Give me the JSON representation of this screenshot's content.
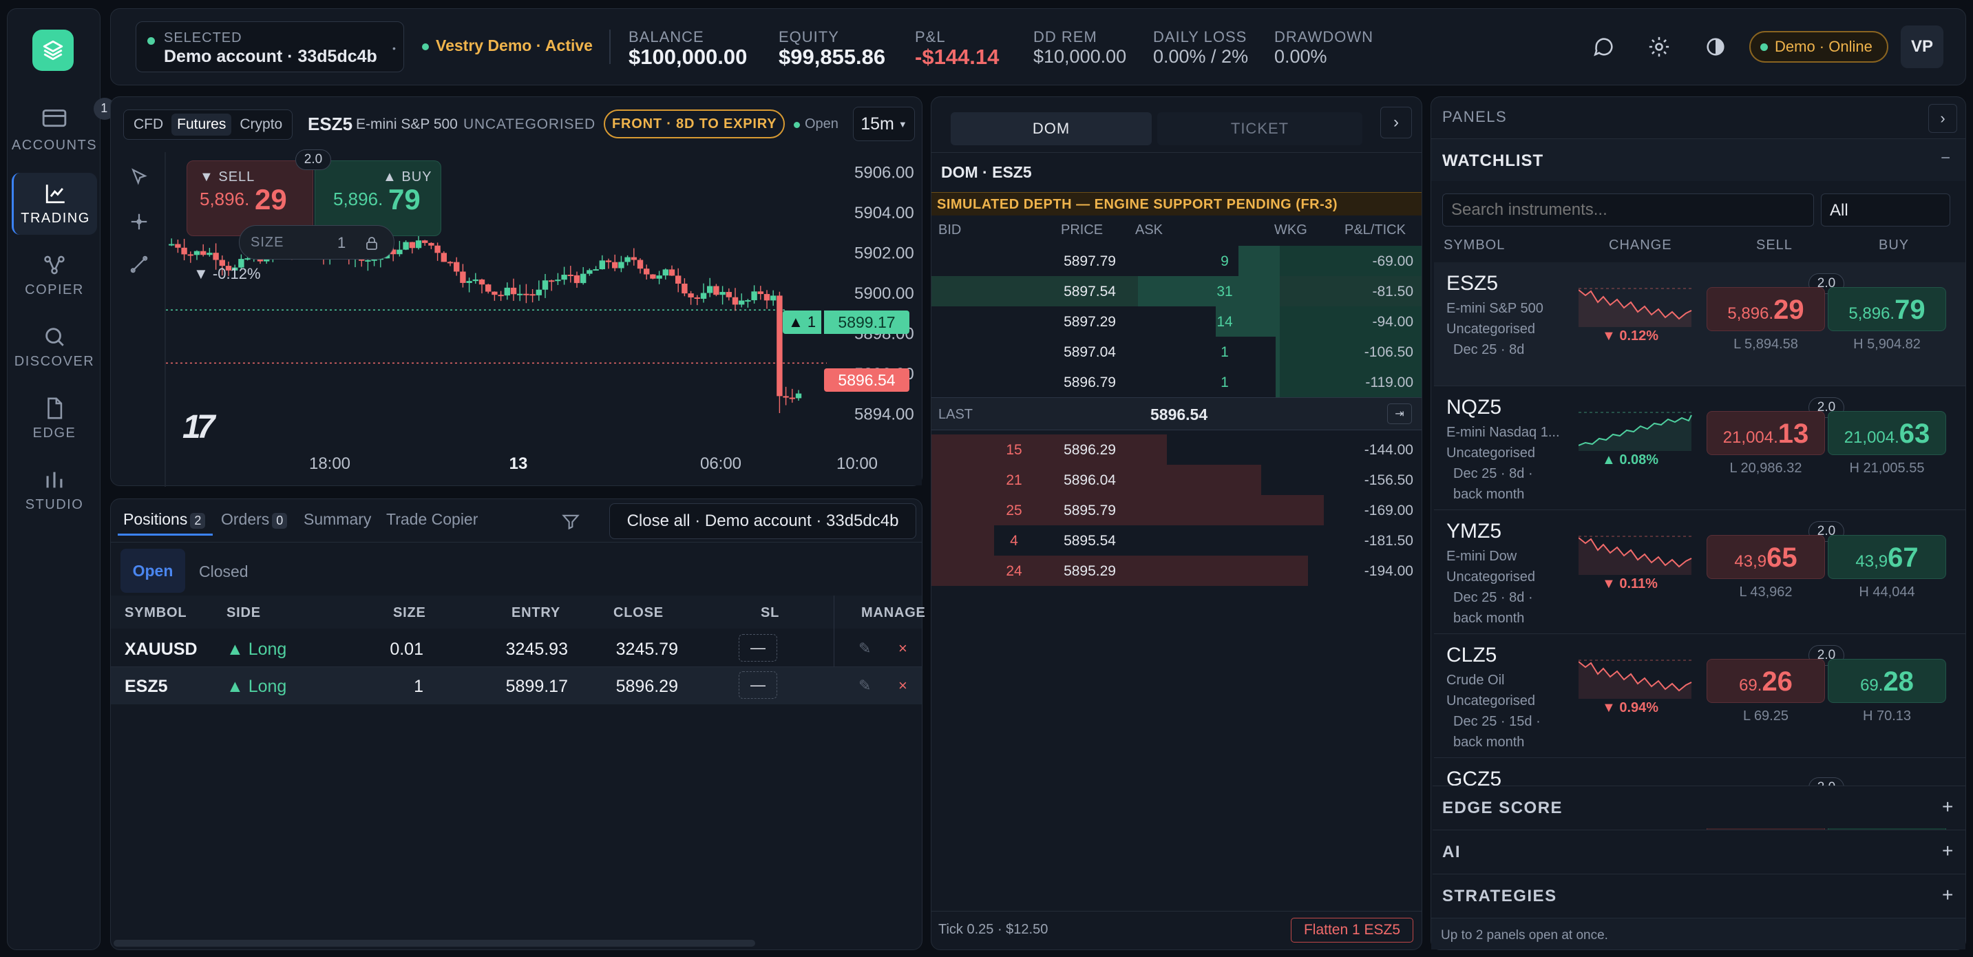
{
  "sidebar": {
    "items": [
      {
        "label": "ACCOUNTS",
        "badge": "1",
        "icon": "accounts-icon"
      },
      {
        "label": "TRADING",
        "icon": "chart-icon"
      },
      {
        "label": "COPIER",
        "icon": "copier-icon"
      },
      {
        "label": "DISCOVER",
        "icon": "search-icon"
      },
      {
        "label": "EDGE",
        "icon": "document-icon"
      },
      {
        "label": "STUDIO",
        "icon": "bar-chart-icon"
      }
    ]
  },
  "header": {
    "selected_label": "SELECTED",
    "selected_account": "Demo account · 33d5dc4b",
    "broker_status": "Vestry Demo · Active",
    "stats": [
      {
        "label": "BALANCE",
        "value": "$100,000.00"
      },
      {
        "label": "EQUITY",
        "value": "$99,855.86"
      },
      {
        "label": "P&L",
        "value": "-$144.14"
      },
      {
        "label": "DD REM",
        "value": "$10,000.00"
      },
      {
        "label": "DAILY LOSS",
        "value": "0.00% / 2%"
      },
      {
        "label": "DRAWDOWN",
        "value": "0.00%"
      }
    ],
    "online_status": "Demo · Online",
    "avatar": "VP"
  },
  "chart": {
    "segments": [
      "CFD",
      "Futures",
      "Crypto"
    ],
    "active_segment": "Futures",
    "symbol": "ESZ5",
    "description": "E-mini S&P 500",
    "category": "UNCATEGORISED",
    "front_badge": "FRONT · 8D TO EXPIRY",
    "status": "Open",
    "timeframe": "15m",
    "sell_label": "▼ SELL",
    "sell_price_small": "5,896.",
    "sell_price_big": "29",
    "buy_label": "▲ BUY",
    "buy_price_small": "5,896.",
    "buy_price_big": "79",
    "spread": "2.0",
    "size_label": "SIZE",
    "size_value": "1",
    "change": "▼ -0.12%",
    "y_ticks": [
      "5906.00",
      "5904.00",
      "5902.00",
      "5900.00",
      "5898.00",
      "5896.00",
      "5894.00"
    ],
    "x_ticks": [
      "18:00",
      "13",
      "06:00",
      "10:00"
    ],
    "entry_tag_qty": "▲ 1",
    "entry_price": "5899.17",
    "last_price": "5896.54",
    "logo_text": "17"
  },
  "positions": {
    "tabs": [
      {
        "label": "Positions",
        "count": "2"
      },
      {
        "label": "Orders",
        "count": "0"
      },
      {
        "label": "Summary"
      },
      {
        "label": "Trade Copier"
      }
    ],
    "close_all": "Close all · Demo account · 33d5dc4b",
    "subtabs": [
      "Open",
      "Closed"
    ],
    "columns": [
      "SYMBOL",
      "SIDE",
      "SIZE",
      "ENTRY",
      "CLOSE",
      "SL",
      "MANAGE"
    ],
    "rows": [
      {
        "symbol": "XAUUSD",
        "side": "▲ Long",
        "size": "0.01",
        "entry": "3245.93",
        "close": "3245.79",
        "sl": "—"
      },
      {
        "symbol": "ESZ5",
        "side": "▲ Long",
        "size": "1",
        "entry": "5899.17",
        "close": "5896.29",
        "sl": "—"
      }
    ]
  },
  "dom": {
    "tabs": [
      "DOM",
      "TICKET"
    ],
    "title": "DOM · ESZ5",
    "notice": "SIMULATED DEPTH — ENGINE SUPPORT PENDING (FR-3)",
    "columns": [
      "BID",
      "PRICE",
      "ASK",
      "WKG",
      "P&L/TICK"
    ],
    "asks": [
      {
        "price": "5897.79",
        "ask": "9",
        "pnl": "-69.00",
        "depth": 0.29
      },
      {
        "price": "5897.54",
        "ask": "31",
        "pnl": "-81.50",
        "depth": 1.0
      },
      {
        "price": "5897.29",
        "ask": "14",
        "pnl": "-94.00",
        "depth": 0.45
      },
      {
        "price": "5897.04",
        "ask": "1",
        "pnl": "-106.50",
        "depth": 0.03
      },
      {
        "price": "5896.79",
        "ask": "1",
        "pnl": "-119.00",
        "depth": 0.03
      }
    ],
    "last_label": "LAST",
    "last_price": "5896.54",
    "bids": [
      {
        "bid": "15",
        "price": "5896.29",
        "pnl": "-144.00",
        "depth": 0.6
      },
      {
        "bid": "21",
        "price": "5896.04",
        "pnl": "-156.50",
        "depth": 0.84
      },
      {
        "bid": "25",
        "price": "5895.79",
        "pnl": "-169.00",
        "depth": 1.0
      },
      {
        "bid": "4",
        "price": "5895.54",
        "pnl": "-181.50",
        "depth": 0.16
      },
      {
        "bid": "24",
        "price": "5895.29",
        "pnl": "-194.00",
        "depth": 0.96
      }
    ],
    "tick_info": "Tick 0.25 · $12.50",
    "flatten": "Flatten 1 ESZ5"
  },
  "watchlist_panel": {
    "panels_title": "PANELS",
    "title": "WATCHLIST",
    "search_placeholder": "Search instruments...",
    "filter_value": "All",
    "columns": [
      "SYMBOL",
      "CHANGE",
      "SELL",
      "BUY"
    ],
    "items": [
      {
        "symbol": "ESZ5",
        "desc": "E-mini S&P 500",
        "category": "Uncategorised",
        "meta1": "Dec 25 · 8d",
        "meta2": "",
        "change": "▼ 0.12%",
        "dir": "dn",
        "sell_s": "5,896.",
        "sell_b": "29",
        "buy_s": "5,896.",
        "buy_b": "79",
        "spread": "2.0",
        "low": "L 5,894.58",
        "high": "H 5,904.82"
      },
      {
        "symbol": "NQZ5",
        "desc": "E-mini Nasdaq 1...",
        "category": "Uncategorised",
        "meta1": "Dec 25 · 8d ·",
        "meta2": "back month",
        "change": "▲ 0.08%",
        "dir": "up",
        "sell_s": "21,004.",
        "sell_b": "13",
        "buy_s": "21,004.",
        "buy_b": "63",
        "spread": "2.0",
        "low": "L 20,986.32",
        "high": "H 21,005.55"
      },
      {
        "symbol": "YMZ5",
        "desc": "E-mini Dow",
        "category": "Uncategorised",
        "meta1": "Dec 25 · 8d ·",
        "meta2": "back month",
        "change": "▼ 0.11%",
        "dir": "dn",
        "sell_s": "43,9",
        "sell_b": "65",
        "buy_s": "43,9",
        "buy_b": "67",
        "spread": "2.0",
        "low": "L 43,962",
        "high": "H 44,044"
      },
      {
        "symbol": "CLZ5",
        "desc": "Crude Oil",
        "category": "Uncategorised",
        "meta1": "Dec 25 · 15d ·",
        "meta2": "back month",
        "change": "▼ 0.94%",
        "dir": "dn",
        "sell_s": "69.",
        "sell_b": "26",
        "buy_s": "69.",
        "buy_b": "28",
        "spread": "2.0",
        "low": "L 69.25",
        "high": "H 70.13"
      },
      {
        "symbol": "GCZ5",
        "spread": "2.0"
      }
    ],
    "sections": [
      "EDGE SCORE",
      "AI",
      "STRATEGIES"
    ],
    "footer": "Up to 2 panels open at once."
  },
  "colors": {
    "up": "#4fd1a0",
    "down": "#f26b6b",
    "accent": "#3dd6a0",
    "warning": "#f0b44c"
  }
}
